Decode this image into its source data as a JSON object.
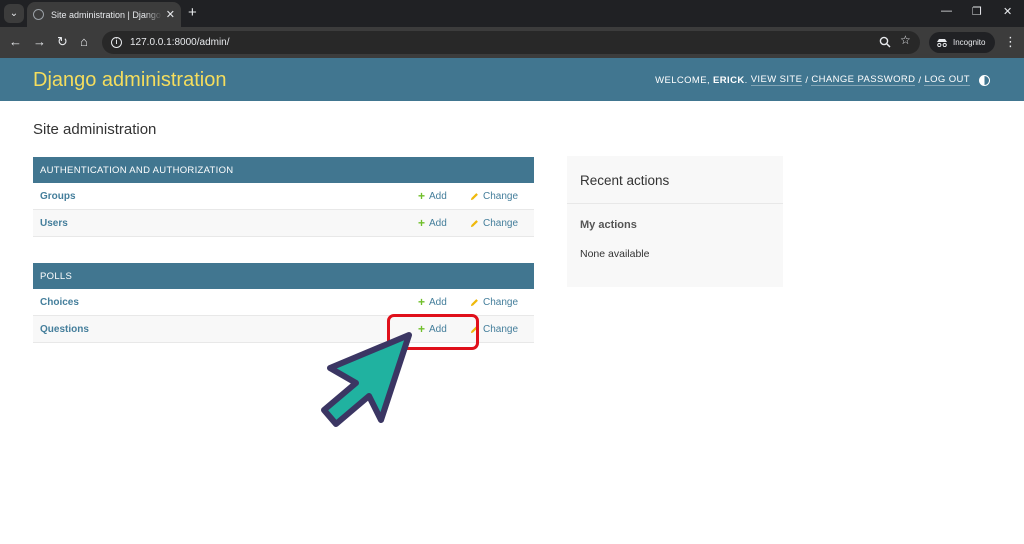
{
  "browser": {
    "tab_title": "Site administration | Django site admin",
    "tab_close": "✕",
    "new_tab": "+",
    "url": "127.0.0.1:8000/admin/",
    "incognito_label": "Incognito",
    "window_controls": [
      "—",
      "❐",
      "✕"
    ]
  },
  "header": {
    "branding": "Django administration",
    "welcome": "WELCOME,",
    "username": "ERICK",
    "view_site": "VIEW SITE",
    "change_password": "CHANGE PASSWORD",
    "log_out": "LOG OUT",
    "separator": "/",
    "accent_color": "#417690",
    "branding_color": "#f5dd5d"
  },
  "page_title": "Site administration",
  "modules": [
    {
      "caption": "AUTHENTICATION AND AUTHORIZATION",
      "models": [
        {
          "name": "Groups",
          "add": "Add",
          "change": "Change"
        },
        {
          "name": "Users",
          "add": "Add",
          "change": "Change"
        }
      ]
    },
    {
      "caption": "POLLS",
      "models": [
        {
          "name": "Choices",
          "add": "Add",
          "change": "Change"
        },
        {
          "name": "Questions",
          "add": "Add",
          "change": "Change"
        }
      ]
    }
  ],
  "recent_actions": {
    "title": "Recent actions",
    "my_actions": "My actions",
    "none_available": "None available"
  },
  "icons": {
    "add": "add-plus-icon",
    "change": "pencil-icon"
  },
  "annotation": {
    "highlight_color": "#e0101b",
    "arrow_fill": "#20b2a0",
    "arrow_outline": "#3b3663"
  }
}
